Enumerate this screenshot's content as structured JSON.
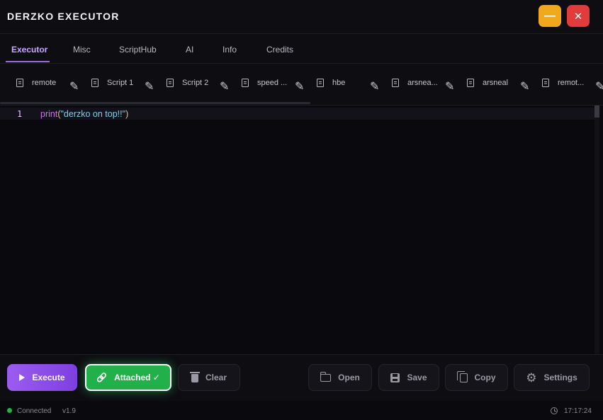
{
  "window": {
    "title": "DERZKO EXECUTOR",
    "minimize_glyph": "—",
    "close_glyph": "✕"
  },
  "main_tabs": [
    {
      "label": "Executor",
      "active": true
    },
    {
      "label": "Misc",
      "active": false
    },
    {
      "label": "ScriptHub",
      "active": false
    },
    {
      "label": "AI",
      "active": false
    },
    {
      "label": "Info",
      "active": false
    },
    {
      "label": "Credits",
      "active": false
    }
  ],
  "script_tabs": [
    {
      "label": "remote"
    },
    {
      "label": "Script 1"
    },
    {
      "label": "Script 2"
    },
    {
      "label": "speed ..."
    },
    {
      "label": "hbe"
    },
    {
      "label": "arsnea..."
    },
    {
      "label": "arsneal"
    },
    {
      "label": "remot..."
    }
  ],
  "script_tab_icons": {
    "file": "file-icon",
    "edit": "pencil-icon",
    "edit_glyph": "✎"
  },
  "editor": {
    "line_number": "1",
    "code": {
      "fn": "print",
      "open_paren": "(",
      "string": "\"derzko on top!!\"",
      "close_paren": ")"
    }
  },
  "toolbar": {
    "execute": "Execute",
    "attached": "Attached ✓",
    "clear": "Clear",
    "open": "Open",
    "save": "Save",
    "copy": "Copy",
    "settings": "Settings",
    "link_glyph": "🔗",
    "gear_glyph": "⚙"
  },
  "status": {
    "connection": "Connected",
    "version": "v1.9",
    "time": "17:17:24"
  },
  "colors": {
    "accent": "#a066f0",
    "attached_green": "#22b04a",
    "minimize": "#f0a81c",
    "close": "#e23b3b",
    "connected_dot": "#23b24b"
  }
}
